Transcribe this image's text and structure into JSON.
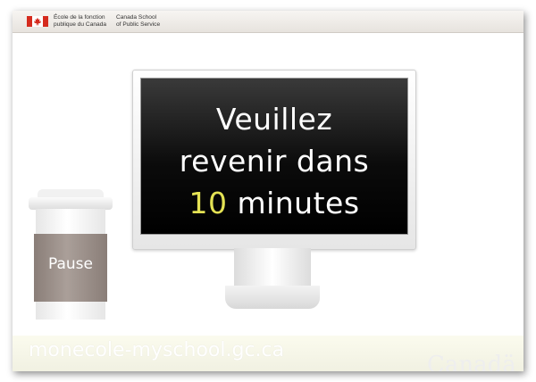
{
  "header": {
    "dept_fr": [
      "École de la fonction",
      "publique du Canada"
    ],
    "dept_en": [
      "Canada School",
      "of Public Service"
    ]
  },
  "screen": {
    "line1": "Veuillez",
    "line2": "revenir dans",
    "number": "10",
    "unit": " minutes"
  },
  "cup": {
    "sleeve_label": "Pause"
  },
  "footer": {
    "url": "monecole-myschool.gc.ca",
    "wordmark": "Canadä"
  },
  "colors": {
    "flag_red": "#d52b1e",
    "highlight": "#e4e254",
    "sleeve": "#a0948e"
  },
  "icons": [
    "canada-flag-icon"
  ]
}
